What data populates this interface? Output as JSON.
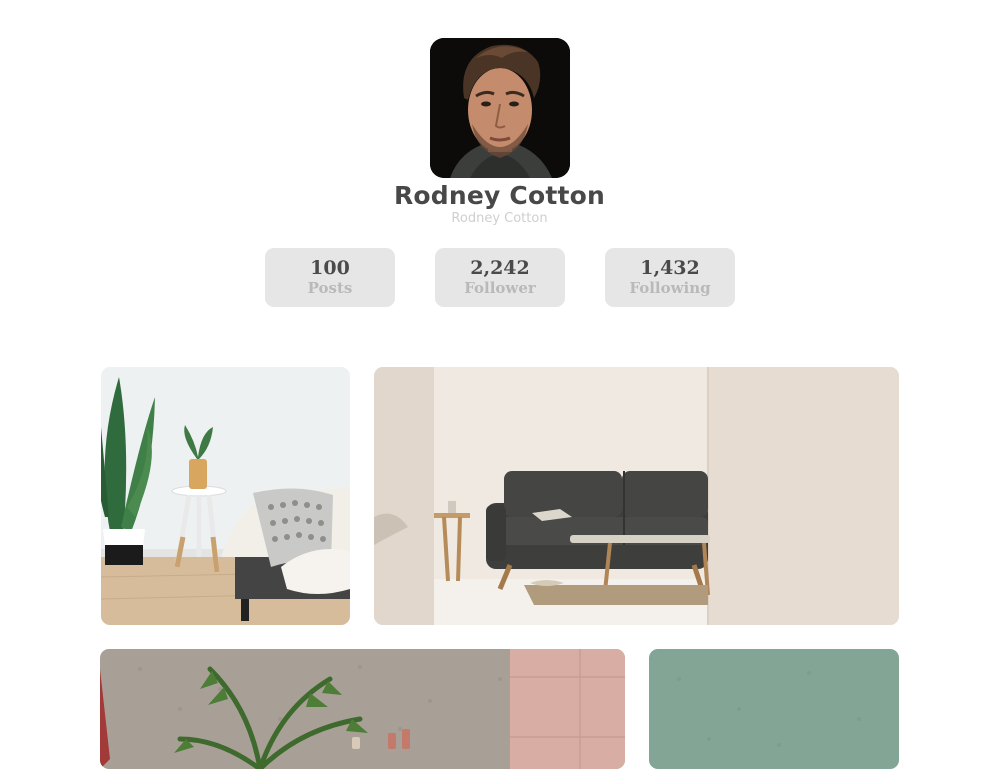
{
  "profile": {
    "name": "Rodney Cotton",
    "handle": "Rodney Cotton",
    "avatar_alt": "profile-photo"
  },
  "stats": [
    {
      "value": "100",
      "label": "Posts"
    },
    {
      "value": "2,242",
      "label": "Follower"
    },
    {
      "value": "1,432",
      "label": "Following"
    }
  ],
  "gallery": [
    {
      "subject": "bedroom-corner-plant"
    },
    {
      "subject": "living-room-sofa"
    },
    {
      "subject": "palm-concrete-wall"
    },
    {
      "subject": "sage-green-wall"
    }
  ],
  "colors": {
    "name_text": "#484848",
    "handle_text": "#cfcfcf",
    "stat_background": "#e6e6e6",
    "stat_value": "#4a4a4a",
    "stat_label": "#b9b9b9"
  }
}
